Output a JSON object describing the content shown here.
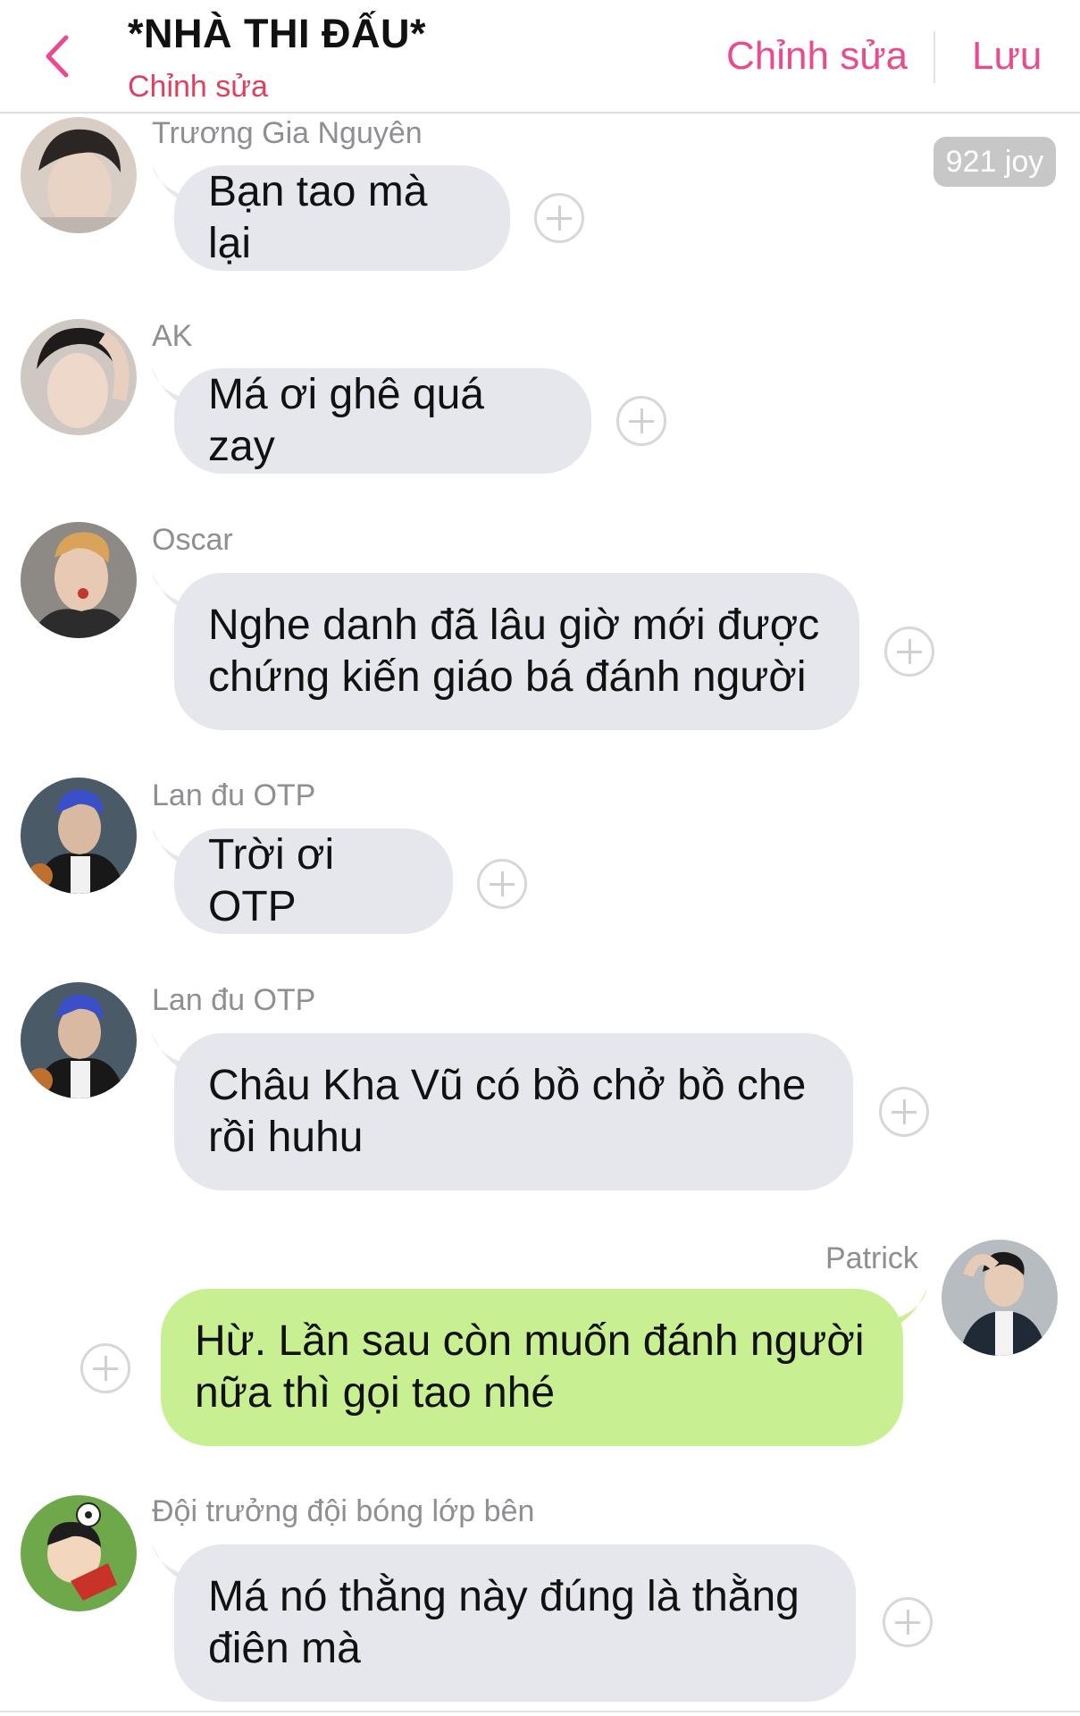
{
  "header": {
    "title": "*NHÀ THI ĐẤU*",
    "subtitle": "Chỉnh sửa",
    "edit_label": "Chỉnh sửa",
    "save_label": "Lưu",
    "accent_color": "#ea4b8e",
    "subtitle_color": "#e0405f"
  },
  "badge": {
    "label": "921 joy"
  },
  "messages": [
    {
      "sender": "Trương Gia Nguyên",
      "text": "Bạn tao mà lại",
      "direction": "incoming"
    },
    {
      "sender": "AK",
      "text": "Má ơi ghê quá zay",
      "direction": "incoming"
    },
    {
      "sender": "Oscar",
      "text": "Nghe danh đã lâu giờ mới được chứng kiến giáo bá đánh người",
      "direction": "incoming"
    },
    {
      "sender": "Lan đu OTP",
      "text": "Trời ơi OTP",
      "direction": "incoming"
    },
    {
      "sender": "Lan đu OTP",
      "text": "Châu Kha Vũ có bồ chở bồ che rồi huhu",
      "direction": "incoming"
    },
    {
      "sender": "Patrick",
      "text": "Hừ. Lần sau còn muốn đánh người nữa thì gọi tao nhé",
      "direction": "outgoing"
    },
    {
      "sender": "Đội trưởng đội bóng lớp bên",
      "text": "Má nó thằng này đúng là thằng điên mà",
      "direction": "incoming"
    }
  ],
  "colors": {
    "incoming_bubble": "#e5e7ec",
    "outgoing_bubble": "#c9ef93"
  },
  "icons": {
    "back": "chevron-left-icon",
    "react": "plus-circle-icon"
  }
}
